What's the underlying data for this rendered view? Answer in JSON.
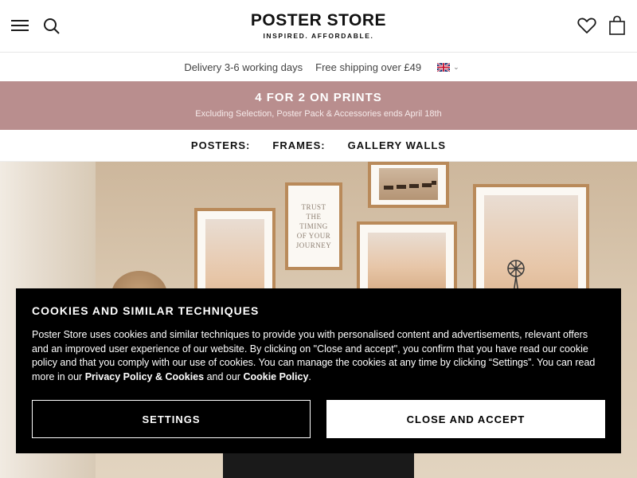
{
  "header": {
    "logo_title": "POSTER STORE",
    "logo_tagline": "INSPIRED. AFFORDABLE.",
    "icons": [
      "menu-icon",
      "search-icon",
      "heart-icon",
      "bag-icon"
    ]
  },
  "infobar": {
    "delivery": "Delivery 3-6 working days",
    "shipping": "Free shipping over £49",
    "country_icon": "uk-flag-icon"
  },
  "promo": {
    "title": "4 FOR 2 ON PRINTS",
    "subtitle": "Excluding Selection, Poster Pack & Accessories ends April 18th",
    "background": "#b98e8e"
  },
  "categories": [
    {
      "label": "POSTERS:"
    },
    {
      "label": "FRAMES:"
    },
    {
      "label": "GALLERY WALLS"
    }
  ],
  "hero": {
    "quote_art_text": "TRUST THE TIMING OF YOUR JOURNEY"
  },
  "cookie": {
    "title": "COOKIES AND SIMILAR TECHNIQUES",
    "text_part1": "Poster Store uses cookies and similar techniques to provide you with personalised content and advertisements, relevant offers and an improved user experience of our website. By clicking on \"Close and accept\", you confirm that you have read our cookie policy and that you comply with our use of cookies. You can manage the cookies at any time by clicking “Settings”. You can read more in our ",
    "privacy_link": "Privacy Policy & Cookies",
    "text_and": " and our ",
    "cookie_link": "Cookie Policy",
    "text_end": ".",
    "settings_label": "SETTINGS",
    "accept_label": "CLOSE AND ACCEPT"
  }
}
